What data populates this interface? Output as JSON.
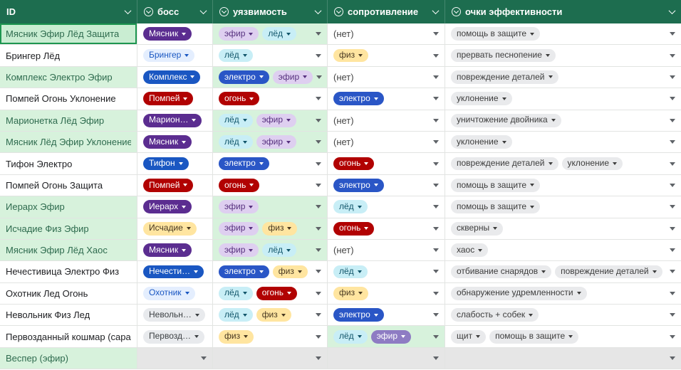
{
  "palette": {
    "boss-purple": {
      "bg": "#5b2d90",
      "fg": "#ffffff"
    },
    "boss-blue": {
      "bg": "#1a57c2",
      "fg": "#ffffff"
    },
    "boss-red": {
      "bg": "#b10202",
      "fg": "#ffffff"
    },
    "boss-lightblue": {
      "bg": "#e4eefe",
      "fg": "#1a57c2"
    },
    "boss-yellow": {
      "bg": "#ffe5a0",
      "fg": "#473821"
    },
    "boss-gray": {
      "bg": "#e8eaed",
      "fg": "#3c4043"
    },
    "ether": {
      "bg": "#decff0",
      "fg": "#56307e"
    },
    "ice": {
      "bg": "#c8eef6",
      "fg": "#11556a"
    },
    "electro": {
      "bg": "#2a56c6",
      "fg": "#ffffff"
    },
    "fire": {
      "bg": "#b10202",
      "fg": "#ffffff"
    },
    "phys": {
      "bg": "#ffe5a0",
      "fg": "#473821"
    },
    "ether-solid": {
      "bg": "#8e7cc3",
      "fg": "#ffffff"
    },
    "effect": {
      "bg": "#e9eaec",
      "fg": "#3d3d3d"
    }
  },
  "theme": {
    "header_bg": "#1d6d4f",
    "header_fg": "#ffffff",
    "green_cell_bg": "#d7f2dc",
    "selected_cell_bg": "#c9edd2",
    "selected_border": "#1d9650",
    "empty_cell_bg": "#e6e6e6",
    "grid_line": "#e2e4e2",
    "arrow_color": "#5f6368"
  },
  "header": {
    "columns": [
      {
        "label": "ID",
        "chip_icon": false
      },
      {
        "label": "босс",
        "chip_icon": true
      },
      {
        "label": "уязвимость",
        "chip_icon": true
      },
      {
        "label": "сопротивление",
        "chip_icon": true
      },
      {
        "label": "очки эффективности",
        "chip_icon": true
      }
    ]
  },
  "rows": [
    {
      "id": {
        "text": "Мясник Эфир Лёд Защита",
        "green": true,
        "selected": true
      },
      "boss": {
        "label": "Мясник",
        "style": "boss-purple"
      },
      "vuln": {
        "green": true,
        "chips": [
          {
            "label": "эфир",
            "style": "ether"
          },
          {
            "label": "лёд",
            "style": "ice"
          }
        ]
      },
      "resist": {
        "none": "(нет)",
        "chips": []
      },
      "effect": {
        "chips": [
          {
            "label": "помощь в защите",
            "style": "effect"
          }
        ]
      }
    },
    {
      "id": {
        "text": "Брингер Лёд"
      },
      "boss": {
        "label": "Брингер",
        "style": "boss-lightblue"
      },
      "vuln": {
        "chips": [
          {
            "label": "лёд",
            "style": "ice"
          }
        ]
      },
      "resist": {
        "chips": [
          {
            "label": "физ",
            "style": "phys"
          }
        ]
      },
      "effect": {
        "chips": [
          {
            "label": "прервать песнопение",
            "style": "effect"
          }
        ]
      }
    },
    {
      "id": {
        "text": "Комплекс Электро Эфир",
        "green": true
      },
      "boss": {
        "label": "Комплекс",
        "style": "boss-blue"
      },
      "vuln": {
        "green": true,
        "chips": [
          {
            "label": "электро",
            "style": "electro"
          },
          {
            "label": "эфир",
            "style": "ether"
          }
        ]
      },
      "resist": {
        "none": "(нет)",
        "chips": []
      },
      "effect": {
        "chips": [
          {
            "label": "повреждение деталей",
            "style": "effect"
          }
        ]
      }
    },
    {
      "id": {
        "text": "Помпей Огонь Уклонение"
      },
      "boss": {
        "label": "Помпей",
        "style": "boss-red"
      },
      "vuln": {
        "chips": [
          {
            "label": "огонь",
            "style": "fire"
          }
        ]
      },
      "resist": {
        "chips": [
          {
            "label": "электро",
            "style": "electro"
          }
        ]
      },
      "effect": {
        "chips": [
          {
            "label": "уклонение",
            "style": "effect"
          }
        ]
      }
    },
    {
      "id": {
        "text": "Марионетка Лёд Эфир",
        "green": true
      },
      "boss": {
        "label": "Марион…",
        "style": "boss-purple"
      },
      "vuln": {
        "green": true,
        "chips": [
          {
            "label": "лёд",
            "style": "ice"
          },
          {
            "label": "эфир",
            "style": "ether"
          }
        ]
      },
      "resist": {
        "none": "(нет)",
        "chips": []
      },
      "effect": {
        "chips": [
          {
            "label": "уничтожение двойника",
            "style": "effect"
          }
        ]
      }
    },
    {
      "id": {
        "text": "Мясник Лёд Эфир Уклонение",
        "green": true
      },
      "boss": {
        "label": "Мясник",
        "style": "boss-purple"
      },
      "vuln": {
        "green": true,
        "chips": [
          {
            "label": "лёд",
            "style": "ice"
          },
          {
            "label": "эфир",
            "style": "ether"
          }
        ]
      },
      "resist": {
        "none": "(нет)",
        "chips": []
      },
      "effect": {
        "chips": [
          {
            "label": "уклонение",
            "style": "effect"
          }
        ]
      }
    },
    {
      "id": {
        "text": "Тифон Электро"
      },
      "boss": {
        "label": "Тифон",
        "style": "boss-blue"
      },
      "vuln": {
        "chips": [
          {
            "label": "электро",
            "style": "electro"
          }
        ]
      },
      "resist": {
        "chips": [
          {
            "label": "огонь",
            "style": "fire"
          }
        ]
      },
      "effect": {
        "chips": [
          {
            "label": "повреждение деталей",
            "style": "effect"
          },
          {
            "label": "уклонение",
            "style": "effect"
          }
        ]
      }
    },
    {
      "id": {
        "text": "Помпей Огонь Защита"
      },
      "boss": {
        "label": "Помпей",
        "style": "boss-red"
      },
      "vuln": {
        "chips": [
          {
            "label": "огонь",
            "style": "fire"
          }
        ]
      },
      "resist": {
        "chips": [
          {
            "label": "электро",
            "style": "electro"
          }
        ]
      },
      "effect": {
        "chips": [
          {
            "label": "помощь в защите",
            "style": "effect"
          }
        ]
      }
    },
    {
      "id": {
        "text": "Иерарх Эфир",
        "green": true
      },
      "boss": {
        "label": "Иерарх",
        "style": "boss-purple"
      },
      "vuln": {
        "green": true,
        "chips": [
          {
            "label": "эфир",
            "style": "ether"
          }
        ]
      },
      "resist": {
        "chips": [
          {
            "label": "лёд",
            "style": "ice"
          }
        ]
      },
      "effect": {
        "chips": [
          {
            "label": "помощь в защите",
            "style": "effect"
          }
        ]
      }
    },
    {
      "id": {
        "text": "Исчадие Физ Эфир",
        "green": true
      },
      "boss": {
        "label": "Исчадие",
        "style": "boss-yellow"
      },
      "vuln": {
        "green": true,
        "chips": [
          {
            "label": "эфир",
            "style": "ether"
          },
          {
            "label": "физ",
            "style": "phys"
          }
        ]
      },
      "resist": {
        "chips": [
          {
            "label": "огонь",
            "style": "fire"
          }
        ]
      },
      "effect": {
        "chips": [
          {
            "label": "скверны",
            "style": "effect"
          }
        ]
      }
    },
    {
      "id": {
        "text": "Мясник Эфир Лёд Хаос",
        "green": true
      },
      "boss": {
        "label": "Мясник",
        "style": "boss-purple"
      },
      "vuln": {
        "green": true,
        "chips": [
          {
            "label": "эфир",
            "style": "ether"
          },
          {
            "label": "лёд",
            "style": "ice"
          }
        ]
      },
      "resist": {
        "none": "(нет)",
        "chips": []
      },
      "effect": {
        "chips": [
          {
            "label": "хаос",
            "style": "effect"
          }
        ]
      }
    },
    {
      "id": {
        "text": "Нечестивица Электро Физ"
      },
      "boss": {
        "label": "Нечести…",
        "style": "boss-blue"
      },
      "vuln": {
        "chips": [
          {
            "label": "электро",
            "style": "electro"
          },
          {
            "label": "физ",
            "style": "phys"
          }
        ]
      },
      "resist": {
        "chips": [
          {
            "label": "лёд",
            "style": "ice"
          }
        ]
      },
      "effect": {
        "chips": [
          {
            "label": "отбивание снарядов",
            "style": "effect"
          },
          {
            "label": "повреждение деталей",
            "style": "effect"
          }
        ]
      }
    },
    {
      "id": {
        "text": "Охотник Лед Огонь"
      },
      "boss": {
        "label": "Охотник",
        "style": "boss-lightblue"
      },
      "vuln": {
        "chips": [
          {
            "label": "лёд",
            "style": "ice"
          },
          {
            "label": "огонь",
            "style": "fire"
          }
        ]
      },
      "resist": {
        "chips": [
          {
            "label": "физ",
            "style": "phys"
          }
        ]
      },
      "effect": {
        "chips": [
          {
            "label": "обнаружение удремленности",
            "style": "effect"
          }
        ]
      }
    },
    {
      "id": {
        "text": "Невольник Физ Лед"
      },
      "boss": {
        "label": "Невольн…",
        "style": "boss-gray"
      },
      "vuln": {
        "chips": [
          {
            "label": "лёд",
            "style": "ice"
          },
          {
            "label": "физ",
            "style": "phys"
          }
        ]
      },
      "resist": {
        "chips": [
          {
            "label": "электро",
            "style": "electro"
          }
        ]
      },
      "effect": {
        "chips": [
          {
            "label": "слабость + собек",
            "style": "effect"
          }
        ]
      }
    },
    {
      "id": {
        "text": "Первозданный кошмар (сара"
      },
      "boss": {
        "label": "Первозд…",
        "style": "boss-gray"
      },
      "vuln": {
        "chips": [
          {
            "label": "физ",
            "style": "phys"
          }
        ]
      },
      "resist": {
        "green": true,
        "chips": [
          {
            "label": "лёд",
            "style": "ice"
          },
          {
            "label": "эфир",
            "style": "ether-solid"
          }
        ]
      },
      "effect": {
        "chips": [
          {
            "label": "щит",
            "style": "effect"
          },
          {
            "label": "помощь в защите",
            "style": "effect"
          }
        ]
      }
    },
    {
      "id": {
        "text": "Веспер (эфир)",
        "green": true
      },
      "boss": {
        "empty": true
      },
      "vuln": {
        "empty": true
      },
      "resist": {
        "empty": true
      },
      "effect": {
        "empty": true
      }
    }
  ]
}
